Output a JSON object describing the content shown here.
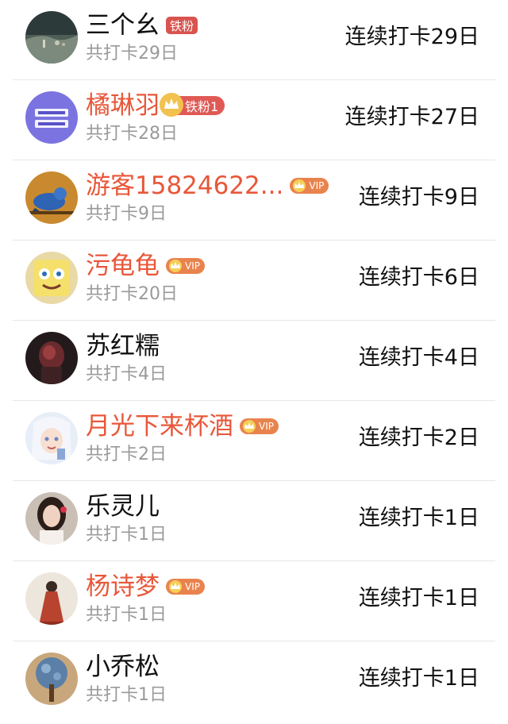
{
  "users": [
    {
      "name": "三个幺",
      "name_color": "normal",
      "badge": "tiefen",
      "badge_text": "铁粉",
      "total": "共打卡29日",
      "streak": "连续打卡29日",
      "avatar": "landscape-dark"
    },
    {
      "name": "橘琳羽",
      "name_color": "vip",
      "badge": "tiefen1",
      "badge_text": "铁粉1",
      "total": "共打卡28日",
      "streak": "连续打卡27日",
      "avatar": "slogan-purple"
    },
    {
      "name": "游客15824622...",
      "name_color": "vip",
      "badge": "vip",
      "badge_text": "VIP",
      "total": "共打卡9日",
      "streak": "连续打卡9日",
      "avatar": "blue-bird"
    },
    {
      "name": "污龟龟",
      "name_color": "vip",
      "badge": "vip",
      "badge_text": "VIP",
      "total": "共打卡20日",
      "streak": "连续打卡6日",
      "avatar": "cartoon-yellow"
    },
    {
      "name": "苏红糯",
      "name_color": "normal",
      "badge": "none",
      "badge_text": "",
      "total": "共打卡4日",
      "streak": "连续打卡4日",
      "avatar": "dark-red"
    },
    {
      "name": "月光下来杯酒",
      "name_color": "vip",
      "badge": "vip",
      "badge_text": "VIP",
      "total": "共打卡2日",
      "streak": "连续打卡2日",
      "avatar": "anime-girl"
    },
    {
      "name": "乐灵儿",
      "name_color": "normal",
      "badge": "none",
      "badge_text": "",
      "total": "共打卡1日",
      "streak": "连续打卡1日",
      "avatar": "portrait-woman"
    },
    {
      "name": "杨诗梦",
      "name_color": "vip",
      "badge": "vip",
      "badge_text": "VIP",
      "total": "共打卡1日",
      "streak": "连续打卡1日",
      "avatar": "red-dress"
    },
    {
      "name": "小乔松",
      "name_color": "normal",
      "badge": "none",
      "badge_text": "",
      "total": "共打卡1日",
      "streak": "连续打卡1日",
      "avatar": "blue-tree"
    }
  ],
  "colors": {
    "vip_name": "#e8573a",
    "badge_tiefen": "#d9534f",
    "badge_vip": "#e9834d",
    "muted_text": "#9a9a9a"
  }
}
